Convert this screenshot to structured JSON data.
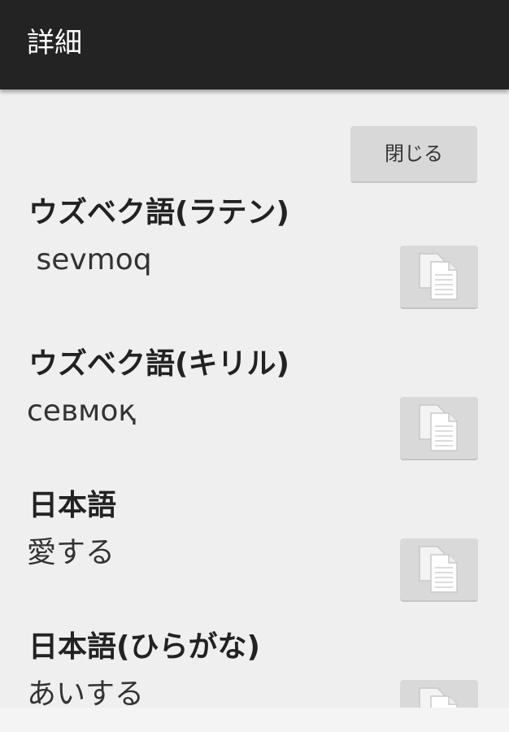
{
  "action_bar": {
    "title": "詳細"
  },
  "close_button": {
    "label": "閉じる"
  },
  "entries": [
    {
      "label": "ウズベク語(ラテン)",
      "value": " sevmoq",
      "copy_icon": "copy-icon"
    },
    {
      "label": "ウズベク語(キリル)",
      "value": "севмоқ",
      "copy_icon": "copy-icon"
    },
    {
      "label": "日本語",
      "value": "愛する",
      "copy_icon": "copy-icon"
    },
    {
      "label": "日本語(ひらがな)",
      "value": "あいする",
      "copy_icon": "copy-icon"
    }
  ],
  "colors": {
    "action_bar_bg": "#232323",
    "background": "#efefef",
    "button_bg": "#d8d8d8"
  }
}
